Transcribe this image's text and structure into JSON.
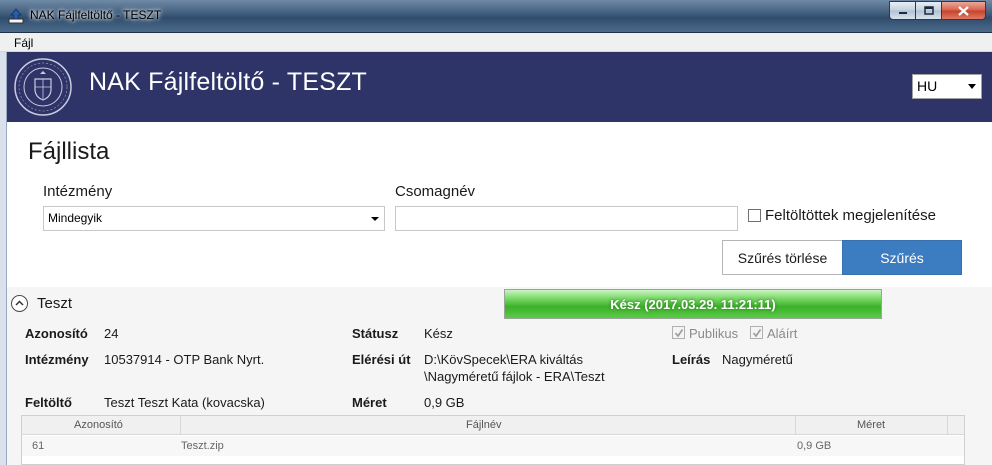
{
  "window": {
    "title": "NAK Fájlfeltöltő - TESZT",
    "menu": [
      "Fájl"
    ]
  },
  "header": {
    "title": "NAK Fájlfeltöltő - TESZT",
    "language": "HU",
    "colors": {
      "background": "#2f3468",
      "text": "#ffffff"
    }
  },
  "page": {
    "title": "Fájllista"
  },
  "filters": {
    "institution_label": "Intézmény",
    "institution_value": "Mindegyik",
    "package_label": "Csomagnév",
    "package_value": "",
    "show_uploaded_label": "Feltöltöttek megjelenítése",
    "show_uploaded_checked": false,
    "clear_button": "Szűrés törlése",
    "filter_button": "Szűrés",
    "accent_color": "#3c7cc0"
  },
  "group": {
    "name": "Teszt",
    "progress_text": "Kész (2017.03.29. 11:21:11)",
    "progress_fraction": 1.0,
    "fields": {
      "id_label": "Azonosító",
      "id_value": "24",
      "institution_label": "Intézmény",
      "institution_value": "10537914 - OTP Bank Nyrt.",
      "uploader_label": "Feltöltő",
      "uploader_value": "Teszt Teszt Kata (kovacska)",
      "status_label": "Státusz",
      "status_value": "Kész",
      "path_label": "Elérési út",
      "path_line1": "D:\\KövSpecek\\ERA kiváltás",
      "path_line2": "\\Nagyméretű fájlok - ERA\\Teszt",
      "size_label": "Méret",
      "size_value": "0,9 GB",
      "public_label": "Publikus",
      "public_checked": true,
      "signed_label": "Aláírt",
      "signed_checked": true,
      "description_label": "Leírás",
      "description_value": "Nagyméretű"
    },
    "table": {
      "columns": [
        "Azonosító",
        "Fájlnév",
        "Méret"
      ],
      "rows": [
        [
          "61",
          "Teszt.zip",
          "0,9 GB"
        ]
      ]
    }
  }
}
